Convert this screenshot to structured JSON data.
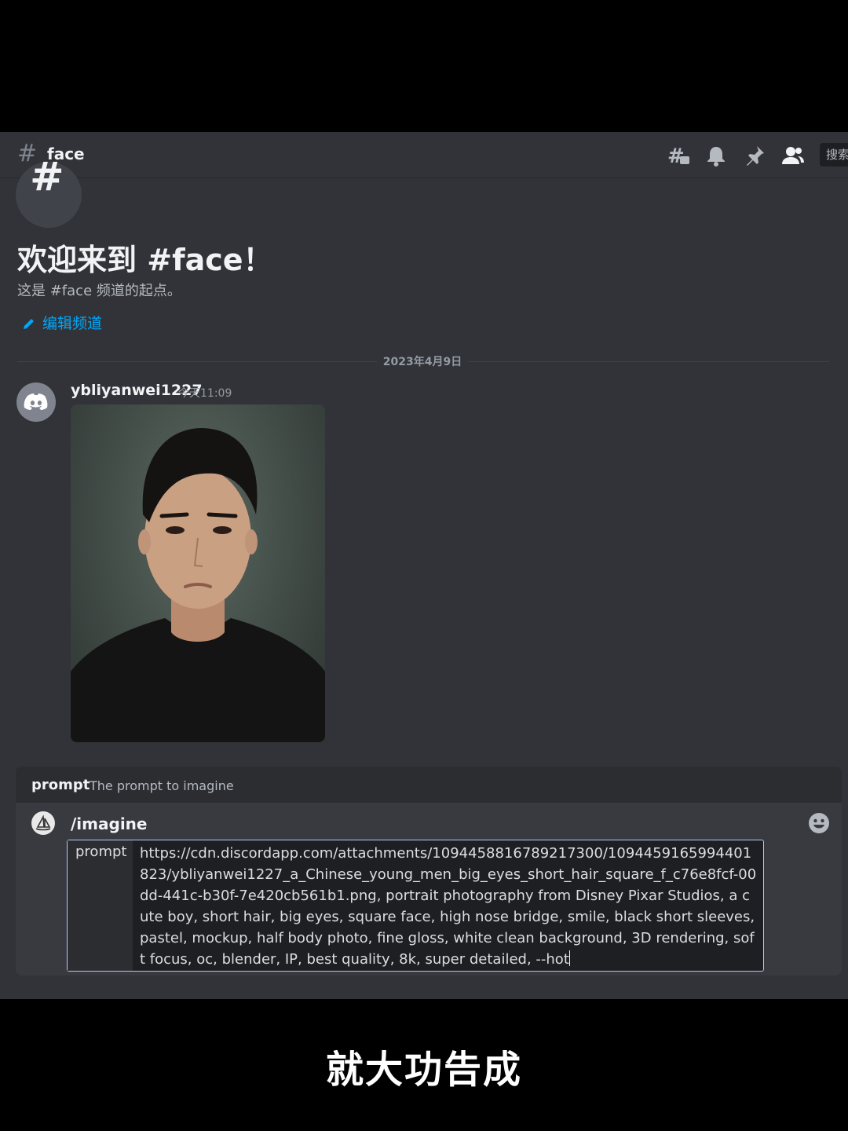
{
  "header": {
    "channel_name": "face",
    "search_placeholder": "搜索"
  },
  "welcome": {
    "title": "欢迎来到 #face！",
    "subtitle": "这是 #face 频道的起点。",
    "edit_channel": "编辑频道"
  },
  "divider": {
    "date": "2023年4月9日"
  },
  "message": {
    "username": "ybliyanwei1227",
    "timestamp": "今天11:09"
  },
  "command": {
    "hint_name": "prompt",
    "hint_desc": "The prompt to imagine",
    "name": "/imagine",
    "option_label": "prompt",
    "option_value": "https://cdn.discordapp.com/attachments/1094458816789217300/1094459165994401823/ybliyanwei1227_a_Chinese_young_men_big_eyes_short_hair_square_f_c76e8fcf-00dd-441c-b30f-7e420cb561b1.png, portrait photography from Disney Pixar Studios, a cute boy, short hair, big eyes, square face, high nose bridge, smile, black short sleeves, pastel, mockup, half body photo, fine gloss, white clean background, 3D rendering, soft focus, oc, blender, IP, best quality, 8k, super detailed, --hot"
  },
  "caption": "就大功告成",
  "colors": {
    "background": "#313338",
    "link": "#00a8fc",
    "input_border": "#b5c7ff"
  },
  "icons": [
    "hash-icon",
    "threads-icon",
    "bell-icon",
    "pin-icon",
    "members-icon",
    "pencil-icon",
    "discord-logo-icon",
    "midjourney-boat-icon",
    "emoji-icon"
  ]
}
